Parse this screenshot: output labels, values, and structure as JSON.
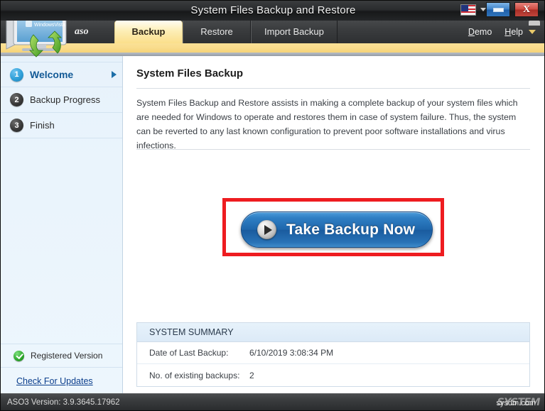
{
  "window": {
    "title": "System Files Backup and Restore",
    "minimize_label": "Minimize",
    "close_label": "X",
    "language_icon": "us-flag-icon"
  },
  "tabbar": {
    "brand": "aso",
    "tabs": [
      {
        "label": "Backup",
        "active": true
      },
      {
        "label": "Restore",
        "active": false
      },
      {
        "label": "Import Backup",
        "active": false
      }
    ],
    "demo_label": "Demo",
    "demo_accel": "D",
    "demo_rest": "emo",
    "help_label": "Help",
    "help_accel": "H",
    "help_rest": "elp"
  },
  "sidebar": {
    "steps": [
      {
        "number": "1",
        "label": "Welcome",
        "active": true
      },
      {
        "number": "2",
        "label": "Backup Progress",
        "active": false
      },
      {
        "number": "3",
        "label": "Finish",
        "active": false
      }
    ],
    "registered_label": "Registered Version",
    "updates_label": "Check For Updates"
  },
  "main": {
    "page_title": "System Files Backup",
    "intro": "System Files Backup and Restore assists in making a complete backup of your system files which are needed for Windows to operate and restores them in case of system failure. Thus, the system can be reverted to any last known configuration to prevent poor software installations and virus infections.",
    "primary_button_label": "Take Backup Now",
    "summary": {
      "header": "SYSTEM SUMMARY",
      "rows": [
        {
          "key": "Date of Last Backup:",
          "value": "6/10/2019 3:08:34 PM"
        },
        {
          "key": "No. of existing backups:",
          "value": "2"
        }
      ]
    }
  },
  "statusbar": {
    "version_text": "ASO3 Version: 3.9.3645.17962",
    "watermark": "SYSTEM",
    "watermark_overlay": "sysdm.com"
  },
  "colors": {
    "accent_blue": "#1d6ea8",
    "tab_active": "#fbdf8b",
    "highlight_red": "#ee1c20",
    "button_blue": "#1e66ab",
    "registered_green": "#2faa2f"
  }
}
